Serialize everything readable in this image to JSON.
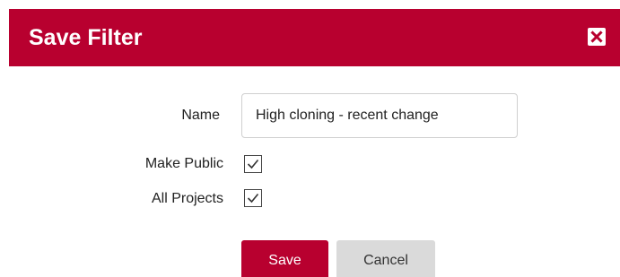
{
  "dialog": {
    "title": "Save Filter",
    "close_icon": "close-icon",
    "accent_color": "#b8002f"
  },
  "form": {
    "name_label": "Name",
    "name_value": "High cloning - recent change",
    "make_public_label": "Make Public",
    "make_public_checked": true,
    "all_projects_label": "All Projects",
    "all_projects_checked": true
  },
  "buttons": {
    "save_label": "Save",
    "cancel_label": "Cancel"
  }
}
